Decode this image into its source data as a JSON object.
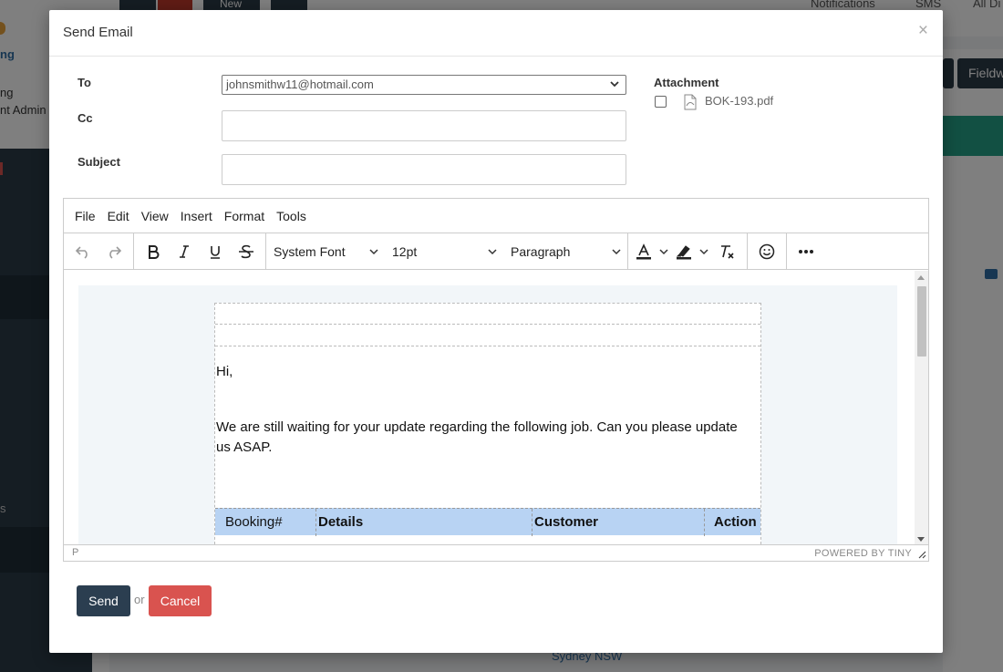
{
  "background": {
    "logo_text": "ng",
    "side_lines": [
      "ng",
      "nt Admin"
    ],
    "side_s": "s",
    "top_new": "New",
    "notifications": "Notifications",
    "sms": "SMS",
    "all": "All Di",
    "fieldwork": "Fieldw",
    "location": "Sydney NSW"
  },
  "modal": {
    "title": "Send Email",
    "close": "×",
    "to_label": "To",
    "to_value": "johnsmithw11@hotmail.com",
    "cc_label": "Cc",
    "subject_label": "Subject",
    "attachment_title": "Attachment",
    "attachment_file": "BOK-193.pdf"
  },
  "editor": {
    "menu": [
      "File",
      "Edit",
      "View",
      "Insert",
      "Format",
      "Tools"
    ],
    "font_family": "System Font",
    "font_size": "12pt",
    "block_format": "Paragraph",
    "greeting": "Hi,",
    "body_text": "We are still waiting for your update regarding the following job. Can you please update us ASAP.",
    "table_headers": [
      "Booking#",
      "Details",
      "Customer",
      "Action"
    ],
    "status_path": "P",
    "powered_by": "POWERED BY TINY"
  },
  "actions": {
    "send": "Send",
    "or": "or",
    "cancel": "Cancel"
  },
  "colors": {
    "send_button": "#2b3e50",
    "cancel_button": "#d9534f",
    "table_header": "#b8d3f3"
  }
}
